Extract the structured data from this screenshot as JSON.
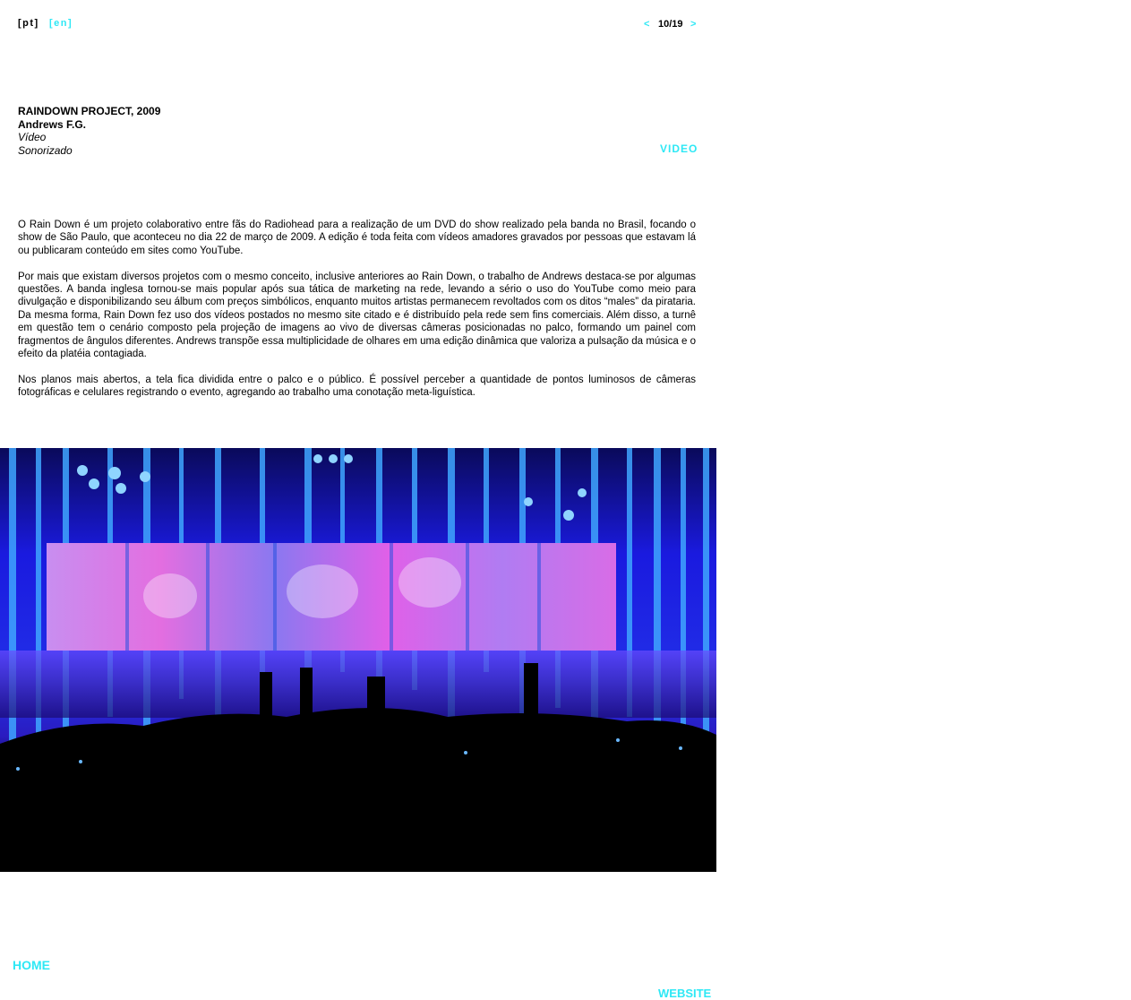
{
  "header": {
    "lang_pt": "[pt]",
    "lang_en": "[en]",
    "prev": "<",
    "page_indicator": "10/19",
    "next": ">"
  },
  "work": {
    "title": "RAINDOWN PROJECT, 2009",
    "artist": "Andrews F.G.",
    "medium": "Vídeo",
    "detail": "Sonorizado",
    "video_link": "VIDEO"
  },
  "description": [
    "O Rain Down é um projeto colaborativo entre fãs do Radiohead para a realização de um DVD do show realizado pela banda no Brasil, focando o show de São Paulo, que aconteceu no dia 22 de março de 2009. A edição é toda feita com vídeos amadores gravados por pessoas que estavam lá ou publicaram conteúdo em sites como YouTube.",
    "Por mais que existam diversos projetos com o mesmo conceito, inclusive anteriores ao Rain Down, o trabalho de Andrews destaca-se por algumas questões. A banda inglesa tornou-se mais popular após sua tática de marketing na rede, levando a sério o uso do YouTube como meio para divulgação e disponibilizando seu álbum com preços simbólicos, enquanto muitos artistas permanecem revoltados com os ditos “males” da pirataria. Da mesma forma, Rain Down fez uso dos vídeos postados no mesmo site citado e é distribuído pela rede sem fins comerciais. Além disso, a turnê em questão tem o cenário composto pela projeção de imagens ao vivo de diversas câmeras posicionadas no palco, formando um painel com fragmentos de ângulos diferentes. Andrews transpõe essa multiplicidade de olhares em uma edição dinâmica que valoriza a pulsação da música e o efeito da platéia contagiada.",
    "Nos planos mais abertos, a tela fica dividida entre o palco e o público. É possível perceber a quantidade de pontos luminosos de câmeras fotográficas e celulares registrando o evento, agregando ao trabalho uma conotação meta-liguística."
  ],
  "footer": {
    "home": "HOME",
    "website": "WEBSITE"
  },
  "colors": {
    "accent": "#2ee8f5",
    "text": "#000000",
    "background": "#ffffff"
  }
}
